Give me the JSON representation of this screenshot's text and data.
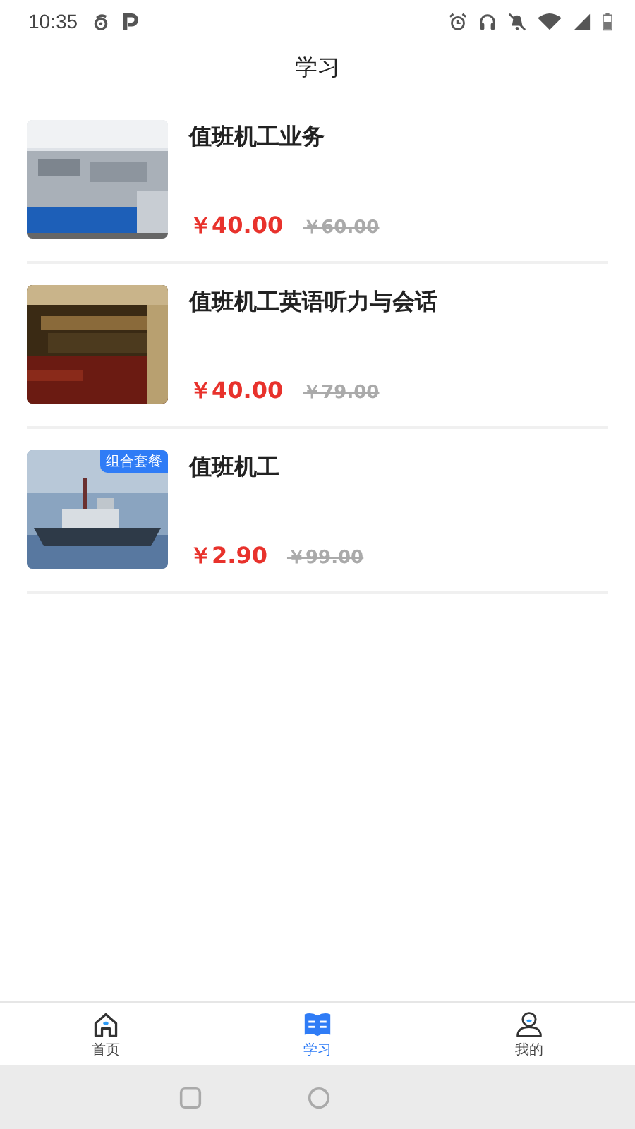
{
  "status_bar": {
    "time": "10:35"
  },
  "header": {
    "title": "学习"
  },
  "courses": [
    {
      "title": "值班机工业务",
      "price": "￥40.00",
      "original_price": "￥60.00"
    },
    {
      "title": "值班机工英语听力与会话",
      "price": "￥40.00",
      "original_price": "￥79.00"
    },
    {
      "title": "值班机工",
      "price": "￥2.90",
      "original_price": "￥99.00",
      "badge": "组合套餐"
    }
  ],
  "tabs": [
    {
      "label": "首页",
      "kind": "home",
      "selected": false
    },
    {
      "label": "学习",
      "kind": "study",
      "selected": true
    },
    {
      "label": "我的",
      "kind": "me",
      "selected": false
    }
  ]
}
